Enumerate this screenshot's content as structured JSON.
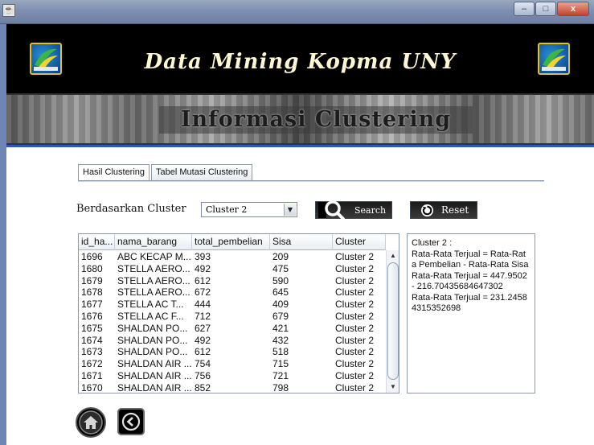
{
  "window": {
    "minimize": "–",
    "maximize": "□",
    "close": "x"
  },
  "header": {
    "title": "Data Mining Kopma UNY",
    "section_title": "Informasi Clustering",
    "logo_left": "KOPMA UNY",
    "logo_right": "KOPMA UNY"
  },
  "tabs": [
    {
      "label": "Hasil Clustering",
      "active": true
    },
    {
      "label": "Tabel Mutasi Clustering",
      "active": false
    }
  ],
  "filter": {
    "label": "Berdasarkan Cluster",
    "selected": "Cluster 2",
    "search_label": "Search",
    "reset_label": "Reset"
  },
  "table": {
    "columns": [
      "id_ha...",
      "nama_barang",
      "total_pembelian",
      "Sisa",
      "Cluster"
    ],
    "rows": [
      [
        "1696",
        "ABC KECAP M...",
        "393",
        "209",
        "Cluster 2"
      ],
      [
        "1680",
        "STELLA AERO...",
        "492",
        "475",
        "Cluster 2"
      ],
      [
        "1679",
        "STELLA AERO...",
        "612",
        "590",
        "Cluster 2"
      ],
      [
        "1678",
        "STELLA AERO...",
        "672",
        "645",
        "Cluster 2"
      ],
      [
        "1677",
        "STELLA AC T...",
        "444",
        "409",
        "Cluster 2"
      ],
      [
        "1676",
        "STELLA AC F...",
        "712",
        "679",
        "Cluster 2"
      ],
      [
        "1675",
        "SHALDAN PO...",
        "627",
        "421",
        "Cluster 2"
      ],
      [
        "1674",
        "SHALDAN PO...",
        "492",
        "432",
        "Cluster 2"
      ],
      [
        "1673",
        "SHALDAN PO...",
        "612",
        "518",
        "Cluster 2"
      ],
      [
        "1672",
        "SHALDAN AIR ...",
        "754",
        "715",
        "Cluster 2"
      ],
      [
        "1671",
        "SHALDAN AIR ...",
        "756",
        "721",
        "Cluster 2"
      ],
      [
        "1670",
        "SHALDAN AIR ...",
        "852",
        "798",
        "Cluster 2"
      ]
    ]
  },
  "info": {
    "text": "Cluster 2 :\nRata-Rata Terjual = Rata-Rata Pembelian - Rata-Rata Sisa\nRata-Rata Terjual = 447.9502 - 216.70435684647302\nRata-Rata Terjual = 231.24584315352698"
  },
  "colors": {
    "accent_line": "#2f54c7",
    "banner_bg": "#000000",
    "title_color": "#fff7d0"
  }
}
